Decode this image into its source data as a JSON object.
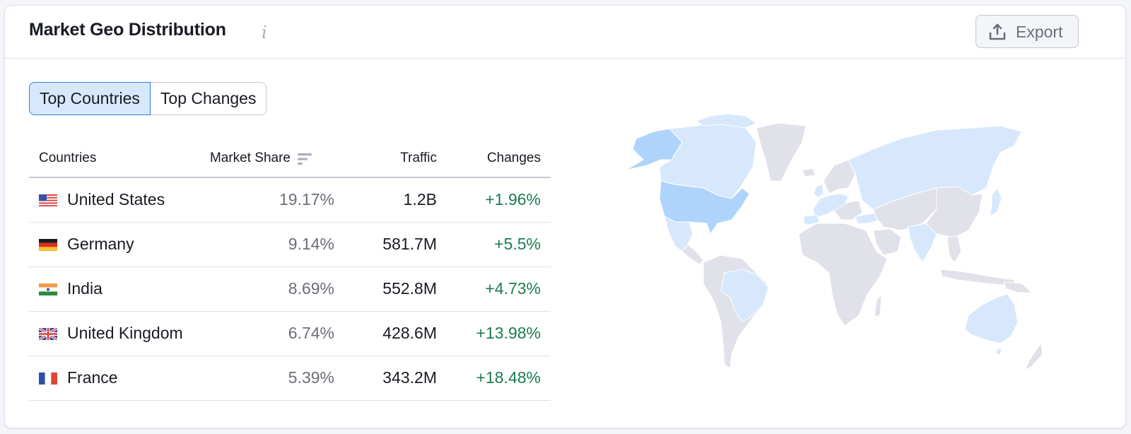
{
  "header": {
    "title": "Market Geo Distribution",
    "info_icon": "info-icon",
    "export_label": "Export",
    "export_icon": "upload-icon"
  },
  "tabs": [
    {
      "label": "Top Countries",
      "active": true
    },
    {
      "label": "Top Changes",
      "active": false
    }
  ],
  "table": {
    "columns": {
      "countries": "Countries",
      "market_share": "Market Share",
      "traffic": "Traffic",
      "changes": "Changes"
    },
    "sort_icon": "sort-descending-icon",
    "rows": [
      {
        "flag": "us-flag-icon",
        "country": "United States",
        "market_share": "19.17%",
        "traffic": "1.2B",
        "change": "+1.96%"
      },
      {
        "flag": "de-flag-icon",
        "country": "Germany",
        "market_share": "9.14%",
        "traffic": "581.7M",
        "change": "+5.5%"
      },
      {
        "flag": "in-flag-icon",
        "country": "India",
        "market_share": "8.69%",
        "traffic": "552.8M",
        "change": "+4.73%"
      },
      {
        "flag": "gb-flag-icon",
        "country": "United Kingdom",
        "market_share": "6.74%",
        "traffic": "428.6M",
        "change": "+13.98%"
      },
      {
        "flag": "fr-flag-icon",
        "country": "France",
        "market_share": "5.39%",
        "traffic": "343.2M",
        "change": "+18.48%"
      }
    ]
  },
  "map": {
    "colors": {
      "strong": "#afd4fb",
      "light": "#d7e8fd",
      "none": "#e0e1e9",
      "positive_change": "#1b7c52",
      "active_tab_bg": "#d7e8fd",
      "active_tab_border": "#2e7ddb"
    },
    "highlighted_strong": [
      "United States"
    ],
    "highlighted_light": [
      "Canada",
      "Mexico",
      "Brazil",
      "Russia",
      "India",
      "Australia",
      "Japan",
      "Germany",
      "France",
      "United Kingdom",
      "Spain",
      "Italy",
      "Poland",
      "Turkey",
      "Netherlands"
    ]
  }
}
